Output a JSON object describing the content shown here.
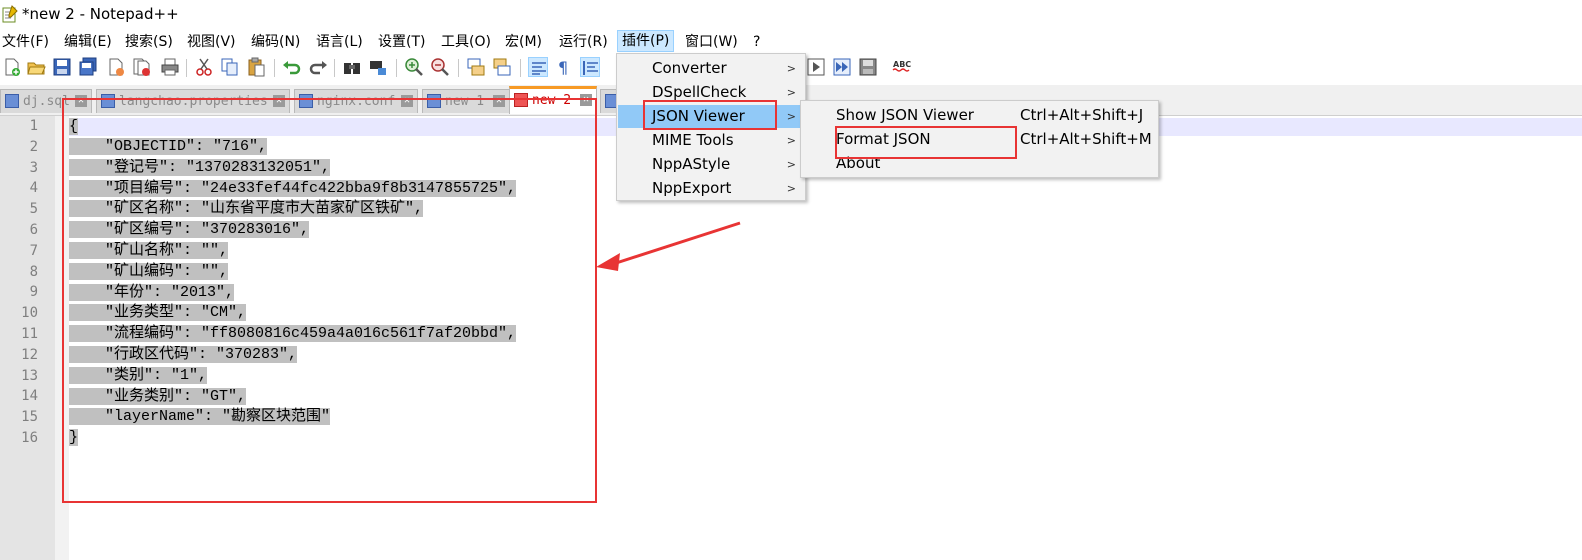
{
  "window": {
    "title": "*new 2 - Notepad++"
  },
  "menubar": {
    "items": [
      "文件(F)",
      "编辑(E)",
      "搜索(S)",
      "视图(V)",
      "编码(N)",
      "语言(L)",
      "设置(T)",
      "工具(O)",
      "宏(M)",
      "运行(R)",
      "插件(P)",
      "窗口(W)",
      "?"
    ],
    "active": "插件(P)"
  },
  "toolbar": {
    "buttons": [
      "new-file-icon",
      "open-file-icon",
      "save-icon",
      "save-all-icon",
      "close-icon",
      "close-all-icon",
      "print-icon",
      "cut-icon",
      "copy-icon",
      "paste-icon",
      "undo-icon",
      "redo-icon",
      "find-icon",
      "replace-icon",
      "zoom-in-icon",
      "zoom-out-icon",
      "sync-vertical-icon",
      "sync-horizontal-icon",
      "word-wrap-icon",
      "show-all-chars-icon",
      "indent-guide-icon",
      "macro-play-icon",
      "macro-run-multiple-icon",
      "macro-save-icon",
      "spellcheck-icon"
    ],
    "spellcheck_label": "ABC"
  },
  "tabs": [
    {
      "label": "dj.sql",
      "active": false
    },
    {
      "label": "langchao.properties",
      "active": false
    },
    {
      "label": "nginx.conf",
      "active": false
    },
    {
      "label": "new 1",
      "active": false
    },
    {
      "label": "new 2",
      "active": true
    }
  ],
  "editor": {
    "line_numbers": [
      "1",
      "2",
      "3",
      "4",
      "5",
      "6",
      "7",
      "8",
      "9",
      "10",
      "11",
      "12",
      "13",
      "14",
      "15",
      "16"
    ],
    "lines": [
      "{",
      "    \"OBJECTID\": \"716\",",
      "    \"登记号\": \"1370283132051\",",
      "    \"项目编号\": \"24e33fef44fc422bba9f8b3147855725\",",
      "    \"矿区名称\": \"山东省平度市大苗家矿区铁矿\",",
      "    \"矿区编号\": \"370283016\",",
      "    \"矿山名称\": \"\",",
      "    \"矿山编码\": \"\",",
      "    \"年份\": \"2013\",",
      "    \"业务类型\": \"CM\",",
      "    \"流程编码\": \"ff8080816c459a4a016c561f7af20bbd\",",
      "    \"行政区代码\": \"370283\",",
      "    \"类别\": \"1\",",
      "    \"业务类别\": \"GT\",",
      "    \"layerName\": \"勘察区块范围\"",
      "}"
    ]
  },
  "plugins_menu": {
    "items": [
      {
        "label": "Converter",
        "submenu": true
      },
      {
        "label": "DSpellCheck",
        "submenu": true
      },
      {
        "label": "JSON Viewer",
        "submenu": true,
        "highlighted": true
      },
      {
        "label": "MIME Tools",
        "submenu": true
      },
      {
        "label": "NppAStyle",
        "submenu": true
      },
      {
        "label": "NppExport",
        "submenu": true
      }
    ]
  },
  "json_viewer_submenu": {
    "items": [
      {
        "label": "Show JSON Viewer",
        "shortcut": "Ctrl+Alt+Shift+J"
      },
      {
        "label": "Format JSON",
        "shortcut": "Ctrl+Alt+Shift+M"
      },
      {
        "label": "About",
        "shortcut": ""
      }
    ]
  },
  "colors": {
    "selection": "#c0c0c0",
    "menu_highlight": "#91c9f7",
    "annotation_red": "#e83434",
    "active_tab_accent": "#f79a25"
  }
}
